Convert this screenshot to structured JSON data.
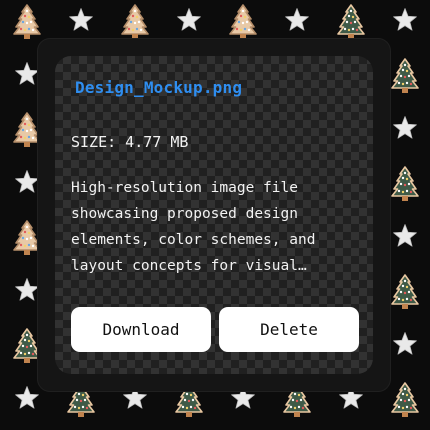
{
  "file": {
    "name": "Design_Mockup.png",
    "size_label": "SIZE: 4.77 MB",
    "description": "High-resolution image file showcasing proposed design elements, color schemes, and layout concepts for visual…"
  },
  "actions": {
    "download_label": "Download",
    "delete_label": "Delete"
  },
  "decorations": {
    "pattern_icons": [
      "gingerbread-tree-icon",
      "star-icon"
    ],
    "colors": {
      "background": "#0c0c0c",
      "tree_cookie": "#e8c9a6",
      "tree_green": "#3f5a47",
      "star": "#e9e9e9",
      "title": "#2f8ef0"
    }
  }
}
